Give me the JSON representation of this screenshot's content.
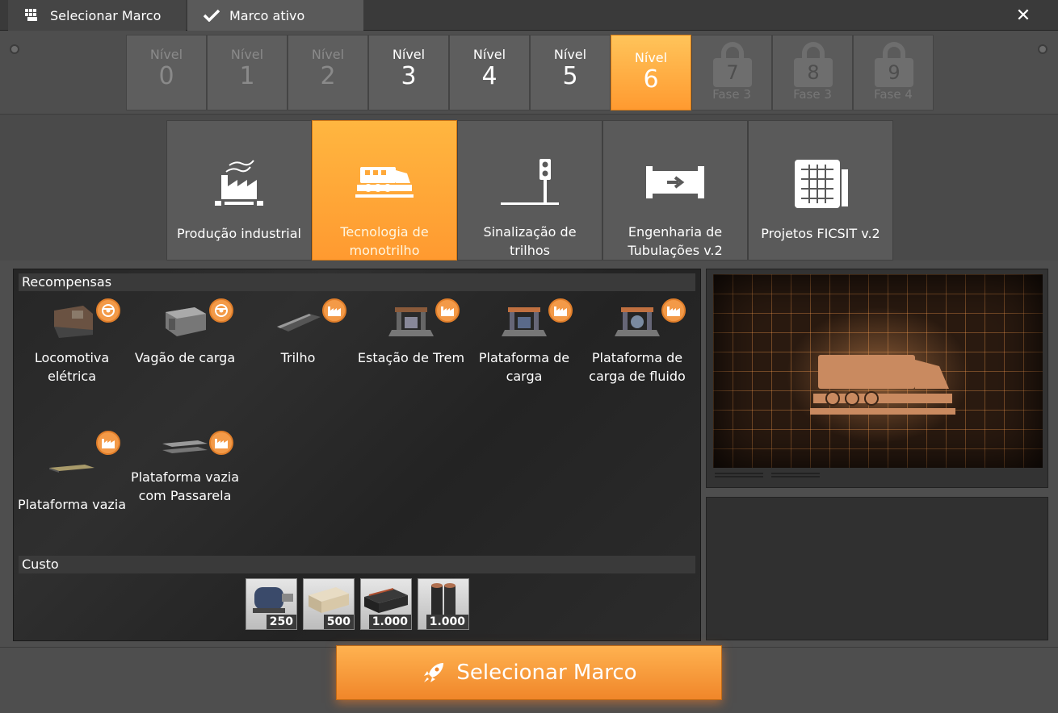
{
  "tabs": {
    "select_milestone": "Selecionar Marco",
    "active_milestone": "Marco ativo",
    "close_symbol": "✕"
  },
  "tiers": [
    {
      "label": "Nível",
      "number": "0",
      "state": "dim"
    },
    {
      "label": "Nível",
      "number": "1",
      "state": "dim"
    },
    {
      "label": "Nível",
      "number": "2",
      "state": "dim"
    },
    {
      "label": "Nível",
      "number": "3",
      "state": "normal"
    },
    {
      "label": "Nível",
      "number": "4",
      "state": "normal"
    },
    {
      "label": "Nível",
      "number": "5",
      "state": "normal"
    },
    {
      "label": "Nível",
      "number": "6",
      "state": "active"
    },
    {
      "number": "7",
      "phase": "Fase 3",
      "state": "locked"
    },
    {
      "number": "8",
      "phase": "Fase 3",
      "state": "locked"
    },
    {
      "number": "9",
      "phase": "Fase 4",
      "state": "locked"
    }
  ],
  "milestones": [
    {
      "label": "Produção industrial",
      "icon": "factory-icon"
    },
    {
      "label": "Tecnologia de monotrilho",
      "icon": "train-icon",
      "active": true
    },
    {
      "label": "Sinalização de trilhos",
      "icon": "signal-icon"
    },
    {
      "label": "Engenharia de Tubulações v.2",
      "icon": "pipe-icon"
    },
    {
      "label": "Projetos FICSIT v.2",
      "icon": "blueprint-icon"
    }
  ],
  "rewards_title": "Recompensas",
  "rewards": [
    {
      "label": "Locomotiva elétrica",
      "badge": "wheel-icon"
    },
    {
      "label": "Vagão de carga",
      "badge": "wheel-icon"
    },
    {
      "label": "Trilho",
      "badge": "factory-icon"
    },
    {
      "label": "Estação de Trem",
      "badge": "factory-icon"
    },
    {
      "label": "Plataforma de carga",
      "badge": "factory-icon"
    },
    {
      "label": "Plataforma de carga de fluido",
      "badge": "factory-icon"
    },
    {
      "label": "Plataforma vazia",
      "badge": "factory-icon"
    },
    {
      "label": "Plataforma vazia com Passarela",
      "badge": "factory-icon"
    }
  ],
  "cost_title": "Custo",
  "costs": [
    {
      "item": "motor-icon",
      "qty": "250"
    },
    {
      "item": "wood-icon",
      "qty": "500"
    },
    {
      "item": "steel-beam-icon",
      "qty": "1.000"
    },
    {
      "item": "steel-pipe-icon",
      "qty": "1.000"
    }
  ],
  "select_button": "Selecionar Marco",
  "colors": {
    "accent": "#ff9a30",
    "badge": "#f39a48",
    "panel": "#2a2a2a"
  }
}
